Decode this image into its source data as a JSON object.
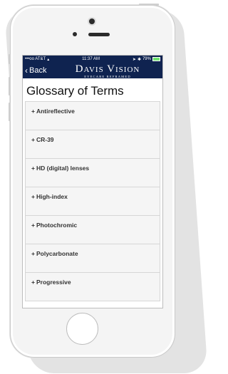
{
  "status": {
    "carrier": "•••oo AT&T",
    "time": "11:37 AM",
    "battery": "79%"
  },
  "nav": {
    "back_label": "Back",
    "brand": "Davis Vision",
    "tagline": "EYECARE REFRAMED"
  },
  "page": {
    "title": "Glossary of Terms"
  },
  "glossary": [
    "Antireflective",
    "CR-39",
    "HD (digital) lenses",
    "High-index",
    "Photochromic",
    "Polycarbonate",
    "Progressive"
  ],
  "colors": {
    "nav_bg": "#0f2350",
    "list_bg": "#f5f5f5"
  }
}
